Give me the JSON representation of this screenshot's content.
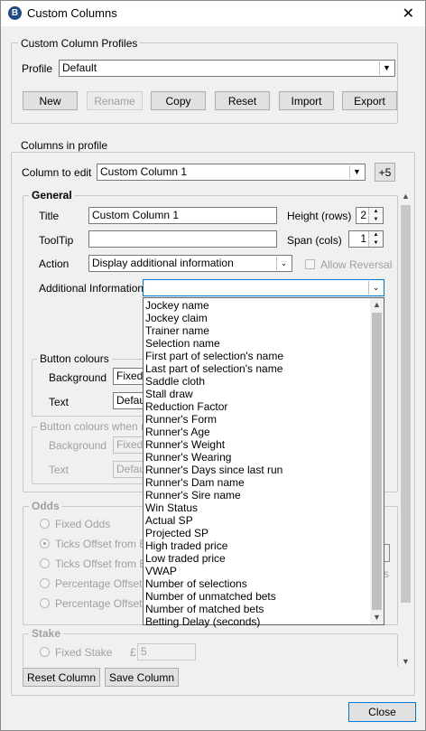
{
  "window": {
    "title": "Custom Columns",
    "app_icon_letter": "B"
  },
  "profiles": {
    "legend": "Custom Column Profiles",
    "profile_label": "Profile",
    "profile_value": "Default",
    "buttons": {
      "new": "New",
      "rename": "Rename",
      "copy": "Copy",
      "reset": "Reset",
      "import": "Import",
      "export": "Export"
    }
  },
  "columns": {
    "legend": "Columns in profile",
    "column_to_edit_label": "Column to edit",
    "column_to_edit_value": "Custom Column 1",
    "plus_button": "+5"
  },
  "general": {
    "legend": "General",
    "title_label": "Title",
    "title_value": "Custom Column 1",
    "height_label": "Height (rows)",
    "height_value": "2",
    "tooltip_label": "ToolTip",
    "tooltip_value": "",
    "span_label": "Span (cols)",
    "span_value": "1",
    "action_label": "Action",
    "action_value": "Display additional information",
    "allow_reversal_label": "Allow Reversal",
    "additional_info_label": "Additional Information",
    "additional_info_value": ""
  },
  "button_colours": {
    "legend": "Button colours",
    "background_label": "Background",
    "background_value": "Fixed",
    "text_label": "Text",
    "text_value": "Defau"
  },
  "button_colours_reversed": {
    "legend": "Button colours when re",
    "background_label": "Background",
    "background_value": "Fixed",
    "text_label": "Text",
    "text_value": "Defau"
  },
  "odds": {
    "legend": "Odds",
    "options": [
      "Fixed Odds",
      "Ticks Offset from B",
      "Ticks Offset from B",
      "Percentage Offset fr",
      "Percentage Offset fr"
    ],
    "side_text": "s"
  },
  "stake": {
    "legend": "Stake",
    "fixed_stake_label": "Fixed Stake",
    "currency": "£",
    "stake_value": "5"
  },
  "bottom_buttons": {
    "reset_column": "Reset Column",
    "save_column": "Save Column",
    "close": "Close"
  },
  "dropdown_items": [
    "Jockey name",
    "Jockey claim",
    "Trainer name",
    "Selection name",
    "First part of selection's name",
    "Last part of selection's name",
    "Saddle cloth",
    "Stall draw",
    "Reduction Factor",
    "Runner's Form",
    "Runner's Age",
    "Runner's Weight",
    "Runner's Wearing",
    "Runner's Days since last run",
    "Runner's Dam name",
    "Runner's Sire name",
    "Win Status",
    "Actual SP",
    "Projected SP",
    "High traded price",
    "Low traded price",
    "VWAP",
    "Number of selections",
    "Number of unmatched bets",
    "Number of matched bets",
    "Betting Delay (seconds)"
  ]
}
